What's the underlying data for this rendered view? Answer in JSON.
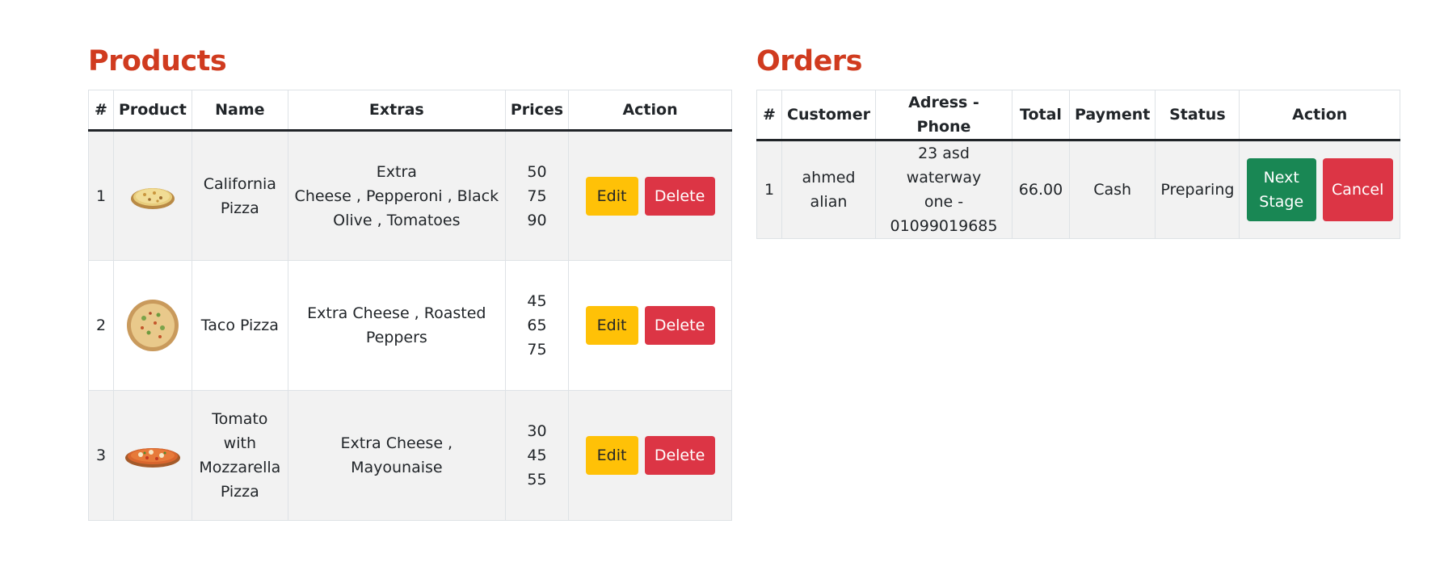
{
  "products": {
    "title": "Products",
    "headers": [
      "#",
      "Product",
      "Name",
      "Extras",
      "Prices",
      "Action"
    ],
    "rows": [
      {
        "num": "1",
        "image_icon": "california-pizza-image",
        "name_lines": [
          "California",
          "Pizza"
        ],
        "extras_lines": [
          "Extra",
          "Cheese , Pepperoni , Black",
          "Olive , Tomatoes"
        ],
        "prices": [
          "50",
          "75",
          "90"
        ],
        "edit_label": "Edit",
        "delete_label": "Delete"
      },
      {
        "num": "2",
        "image_icon": "taco-pizza-image",
        "name_lines": [
          "Taco Pizza"
        ],
        "extras_lines": [
          "Extra Cheese , Roasted",
          "Peppers"
        ],
        "prices": [
          "45",
          "65",
          "75"
        ],
        "edit_label": "Edit",
        "delete_label": "Delete"
      },
      {
        "num": "3",
        "image_icon": "tomato-mozzarella-pizza-image",
        "name_lines": [
          "Tomato with",
          "Mozzarella",
          "Pizza"
        ],
        "extras_lines": [
          "Extra Cheese , Mayounaise"
        ],
        "prices": [
          "30",
          "45",
          "55"
        ],
        "edit_label": "Edit",
        "delete_label": "Delete"
      }
    ]
  },
  "orders": {
    "title": "Orders",
    "headers": [
      "#",
      "Customer",
      "Adress - Phone",
      "Total",
      "Payment",
      "Status",
      "Action"
    ],
    "rows": [
      {
        "num": "1",
        "customer_lines": [
          "ahmed",
          "alian"
        ],
        "address_lines": [
          "23 asd waterway",
          "one -",
          "01099019685"
        ],
        "total": "66.00",
        "payment": "Cash",
        "status": "Preparing",
        "next_lines": [
          "Next",
          "Stage"
        ],
        "cancel_label": "Cancel"
      }
    ]
  },
  "colors": {
    "title": "#d03b1f",
    "edit": "#ffc107",
    "delete": "#dc3545",
    "next": "#198754"
  }
}
